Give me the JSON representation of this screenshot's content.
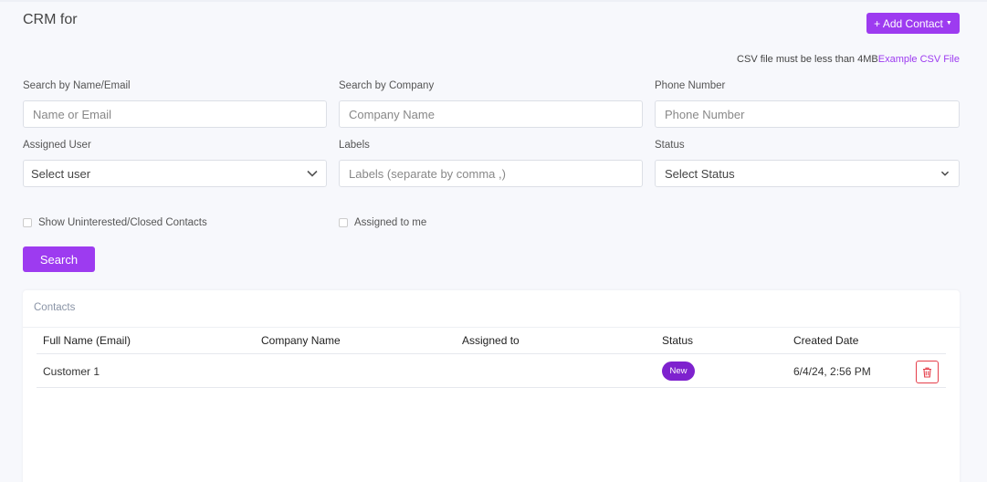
{
  "header": {
    "title": "CRM for",
    "add_contact_label": "+ Add Contact",
    "csv_note": "CSV file must be less than 4MB",
    "csv_link": "Example CSV File"
  },
  "filters": {
    "name_email": {
      "label": "Search by Name/Email",
      "placeholder": "Name or Email"
    },
    "company": {
      "label": "Search by Company",
      "placeholder": "Company Name"
    },
    "phone": {
      "label": "Phone Number",
      "placeholder": "Phone Number"
    },
    "assigned_user": {
      "label": "Assigned User",
      "value": "Select user"
    },
    "labels": {
      "label": "Labels",
      "placeholder": "Labels (separate by comma ,)"
    },
    "status": {
      "label": "Status",
      "value": "Select Status"
    },
    "show_uninterested_label": "Show Uninterested/Closed Contacts",
    "assigned_to_me_label": "Assigned to me",
    "search_label": "Search"
  },
  "contacts": {
    "title": "Contacts",
    "columns": [
      "Full Name (Email)",
      "Company Name",
      "Assigned to",
      "Status",
      "Created Date"
    ],
    "rows": [
      {
        "full_name": "Customer 1",
        "company": "",
        "assigned_to": "",
        "status": "New",
        "created": "6/4/24, 2:56 PM"
      }
    ]
  },
  "colors": {
    "accent": "#9d3bf0",
    "badge": "#7e22ce",
    "delete": "#e53e4a"
  },
  "icons": {
    "dropdown_caret": "caret-down-icon",
    "select_chevron": "chevron-down-icon",
    "delete": "trash-icon"
  }
}
